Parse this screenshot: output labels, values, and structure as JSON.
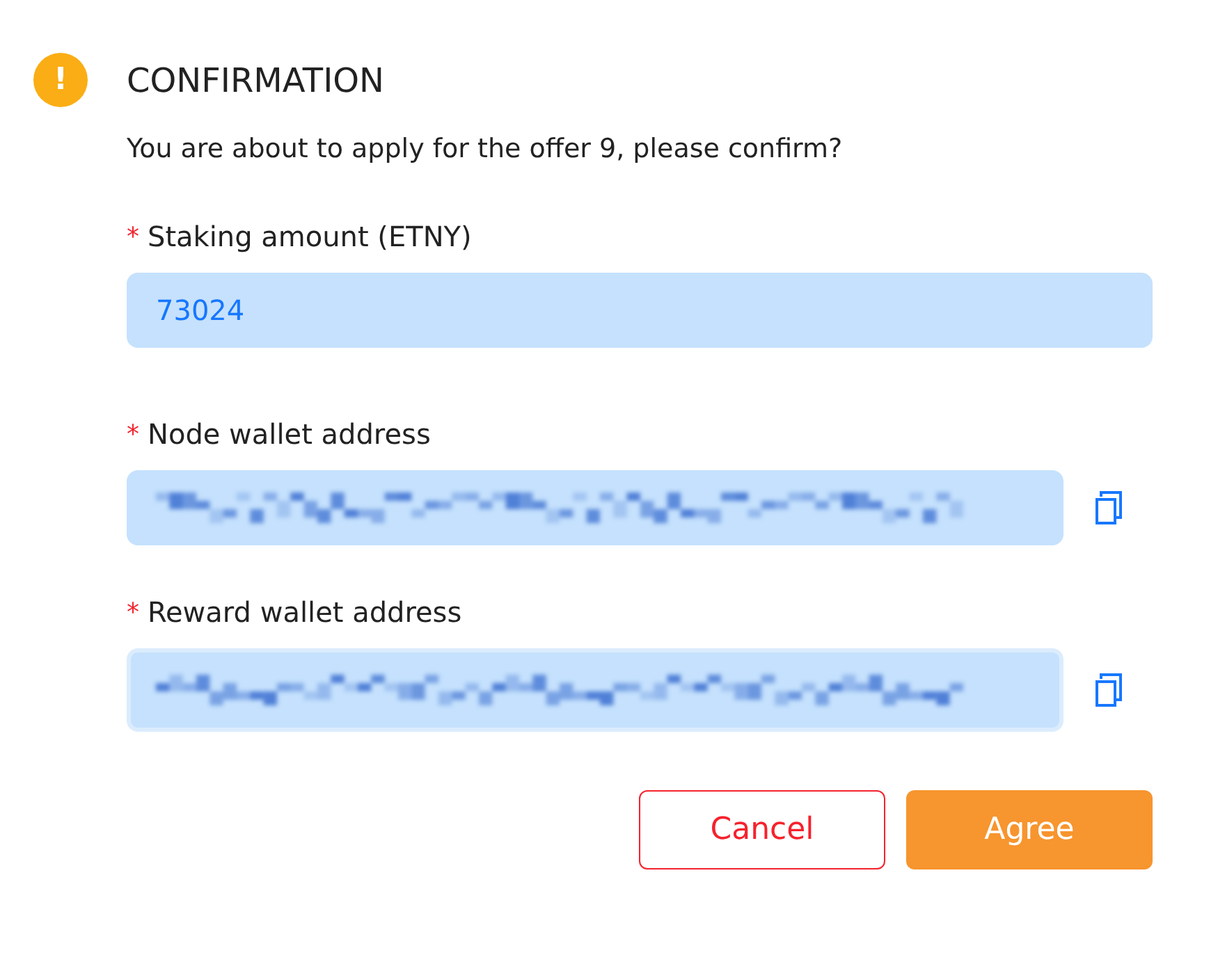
{
  "dialog": {
    "icon": "!",
    "title": "CONFIRMATION",
    "message": "You are about to apply for the offer 9, please confirm?"
  },
  "fields": [
    {
      "kind": "text",
      "marker": "*",
      "label": "Staking amount (ETNY)",
      "value": "73024",
      "focused": false,
      "copyable": false
    },
    {
      "kind": "redacted",
      "marker": "*",
      "label": "Node wallet address",
      "focused": false,
      "copyable": true
    },
    {
      "kind": "redacted",
      "marker": "*",
      "label": "Reward wallet address",
      "focused": true,
      "copyable": true
    }
  ],
  "buttons": [
    {
      "kind": "secondary",
      "label": "Cancel"
    },
    {
      "kind": "primary",
      "label": "Agree"
    }
  ]
}
